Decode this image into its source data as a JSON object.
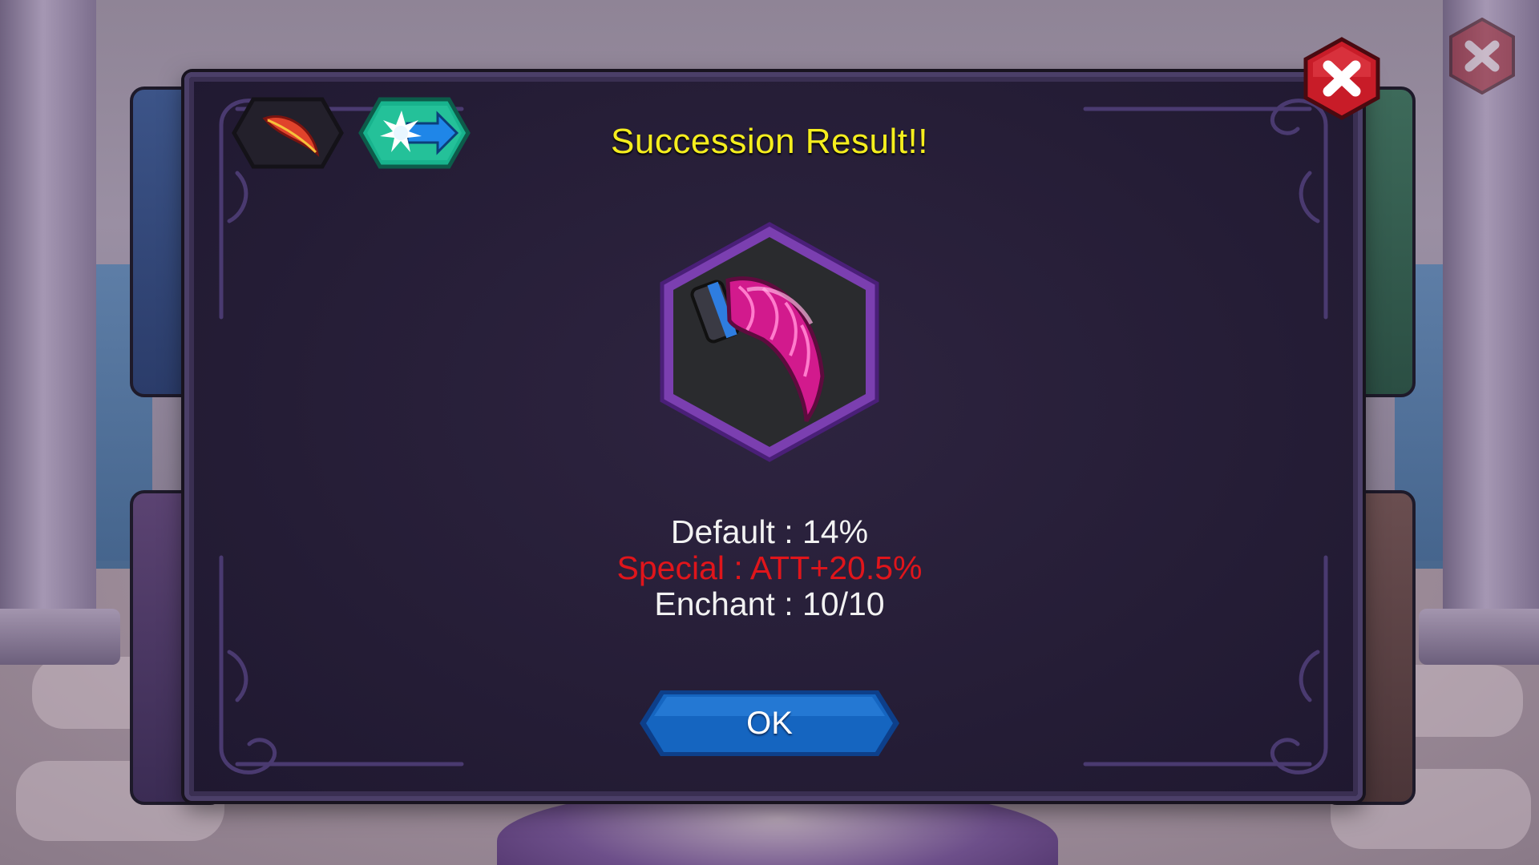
{
  "dialog": {
    "title": "Succession Result!!",
    "stats": {
      "default": "Default :  14%",
      "special": "Special : ATT+20.5%",
      "enchant": "Enchant : 10/10"
    },
    "ok_label": "OK"
  },
  "tabs": [
    {
      "icon": "feather-icon"
    },
    {
      "icon": "arrow-burst-icon"
    }
  ],
  "item": {
    "icon": "pink-claw-icon"
  },
  "colors": {
    "title": "#f5ee1e",
    "special": "#e0151b",
    "stat_text": "#f2f2f2",
    "ok_button": "#1565c0",
    "close_button": "#d01f2a",
    "panel_bg": "#251d36",
    "slot_border": "#7b3fb0"
  }
}
